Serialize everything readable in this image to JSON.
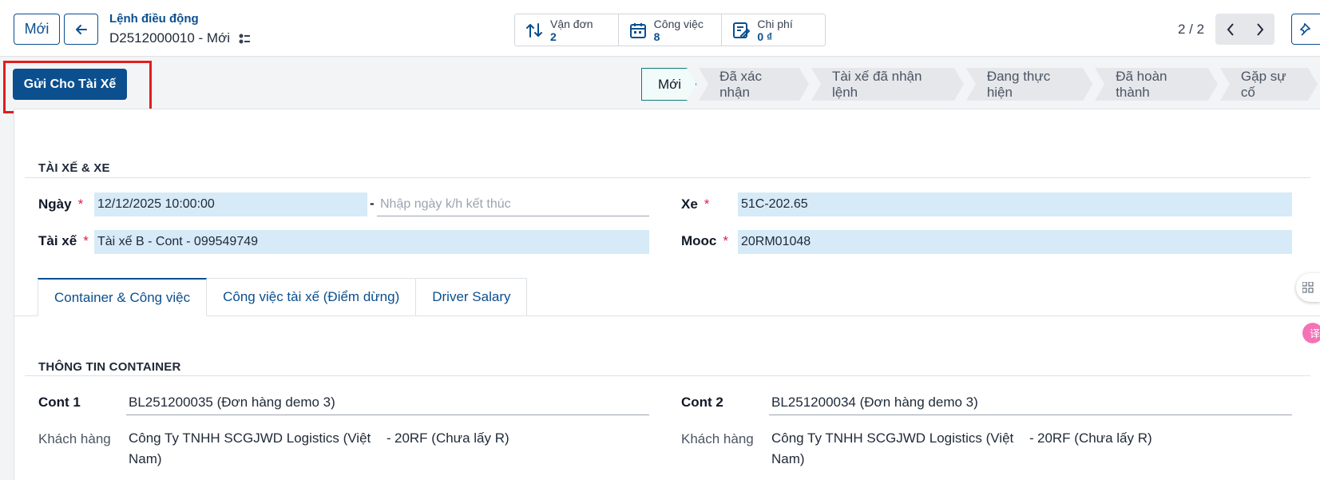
{
  "header": {
    "new_button": "Mới",
    "breadcrumb_parent": "Lệnh điều động",
    "record_name": "D2512000010 - Mới"
  },
  "smart_buttons": [
    {
      "label": "Vận đơn",
      "value": "2",
      "icon": "transfer-arrows-icon"
    },
    {
      "label": "Công việc",
      "value": "8",
      "icon": "calendar-icon"
    },
    {
      "label": "Chi phí",
      "value": "0 ₫",
      "icon": "edit-note-icon"
    }
  ],
  "pager": {
    "value": "2 / 2"
  },
  "actions": {
    "send_to_driver": "Gửi Cho Tài Xế"
  },
  "statusbar": {
    "stages": [
      "Mới",
      "Đã xác nhận",
      "Tài xế đã nhận lệnh",
      "Đang thực hiện",
      "Đã hoàn thành",
      "Gặp sự cố"
    ],
    "active": "Mới"
  },
  "driver_section": {
    "title": "TÀI XẾ & XE",
    "date_label": "Ngày",
    "date_value": "12/12/2025 10:00:00",
    "date_end_placeholder": "Nhập ngày k/h kết thúc",
    "driver_label": "Tài xế",
    "driver_value": "Tài xế B - Cont - 099549749",
    "vehicle_label": "Xe",
    "vehicle_value": "51C-202.65",
    "trailer_label": "Mooc",
    "trailer_value": "20RM01048"
  },
  "tabs": [
    "Container & Công việc",
    "Công việc tài xế (Điểm dừng)",
    "Driver Salary"
  ],
  "container_section": {
    "title": "THÔNG TIN CONTAINER",
    "cont1_label": "Cont 1",
    "cont1_value": "BL251200035 (Đơn hàng demo 3)",
    "cont2_label": "Cont 2",
    "cont2_value": "BL251200034 (Đơn hàng demo 3)",
    "customer_label": "Khách hàng",
    "customer1_value_line1": "Công Ty TNHH SCGJWD Logistics (Việt",
    "customer1_value_line2": "Nam)",
    "customer1_type": "20RF (Chưa lấy R)",
    "customer2_value_line1": "Công Ty TNHH SCGJWD Logistics (Việt",
    "customer2_value_line2": "Nam)",
    "customer2_type": "20RF (Chưa lấy R)"
  },
  "colors": {
    "primary": "#0b4f8f",
    "highlight": "#e11d1d",
    "field_bg": "#d6eaf8",
    "active_stage_border": "#0e7c7b"
  }
}
